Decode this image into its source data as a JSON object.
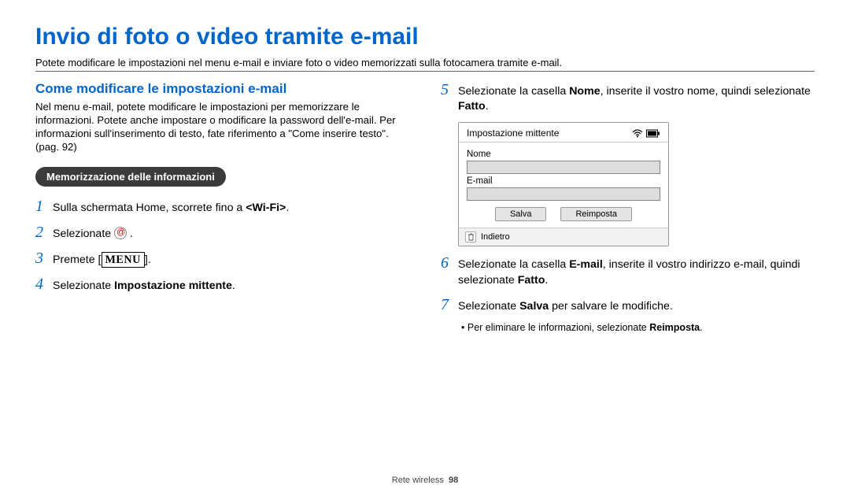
{
  "page_title": "Invio di foto o video tramite e-mail",
  "subtitle": "Potete modificare le impostazioni nel menu e-mail e inviare foto o video memorizzati sulla fotocamera tramite e-mail.",
  "left": {
    "heading": "Come modificare le impostazioni e-mail",
    "desc": "Nel menu e-mail, potete modificare le impostazioni per memorizzare le informazioni. Potete anche impostare o modificare la password dell'e-mail. Per informazioni sull'inserimento di testo, fate riferimento a \"Come inserire testo\". (pag. 92)",
    "pill": "Memorizzazione delle informazioni",
    "steps": {
      "s1_pre": "Sulla schermata Home, scorrete fino a ",
      "s1_bold": "<Wi-Fi>",
      "s1_post": ".",
      "s2_pre": "Selezionate ",
      "s3_pre": "Premete [",
      "s3_menu": "MENU",
      "s3_post": "].",
      "s4_pre": "Selezionate ",
      "s4_bold": "Impostazione mittente",
      "s4_post": "."
    }
  },
  "right": {
    "s5_pre": "Selezionate la casella ",
    "s5_b1": "Nome",
    "s5_mid": ", inserite il vostro nome, quindi selezionate ",
    "s5_b2": "Fatto",
    "s5_post": ".",
    "camera": {
      "title": "Impostazione mittente",
      "label_name": "Nome",
      "label_email": "E-mail",
      "btn_save": "Salva",
      "btn_reset": "Reimposta",
      "footer": "Indietro"
    },
    "s6_pre": "Selezionate la casella ",
    "s6_b1": "E-mail",
    "s6_mid": ", inserite il vostro indirizzo e-mail, quindi selezionate ",
    "s6_b2": "Fatto",
    "s6_post": ".",
    "s7_pre": "Selezionate ",
    "s7_b1": "Salva",
    "s7_post": " per salvare le modifiche.",
    "bullet_pre": "Per eliminare le informazioni, selezionate ",
    "bullet_b": "Reimposta",
    "bullet_post": "."
  },
  "footer_section": "Rete wireless",
  "footer_page": "98"
}
